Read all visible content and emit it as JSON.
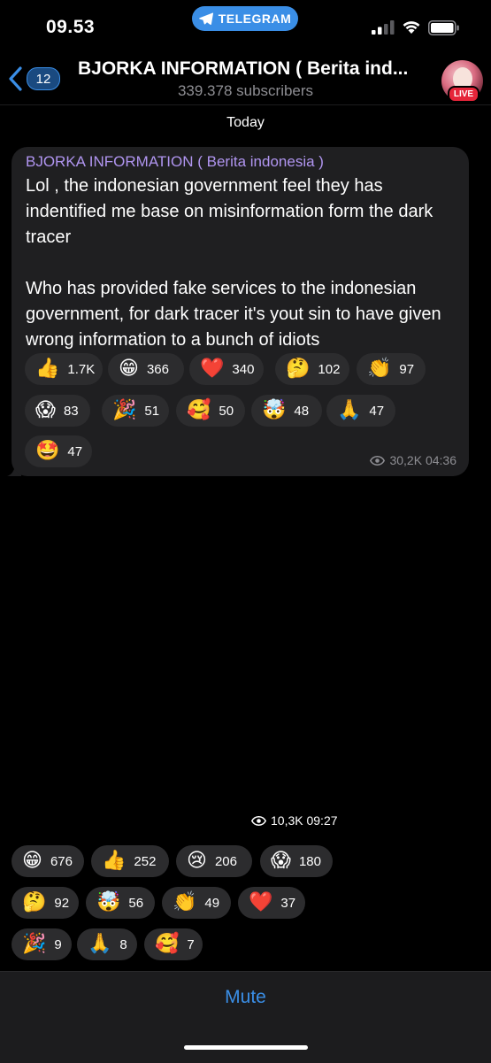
{
  "status_bar": {
    "time": "09.53",
    "app_pill": "TELEGRAM"
  },
  "header": {
    "back_badge": "12",
    "title": "BJORKA INFORMATION ( Berita ind...",
    "subtitle": "339.378 subscribers",
    "live_badge": "LIVE"
  },
  "date_label": "Today",
  "message1": {
    "author": "BJORKA INFORMATION ( Berita indonesia )",
    "paragraph1": "Lol , the indonesian government feel they has indentified me base on misinformation form the dark tracer",
    "paragraph2": "Who has provided fake services to the indonesian government, for dark tracer it's yout sin to have given wrong information to a bunch of idiots",
    "views": "30,2K",
    "time": "04:36",
    "reactions": [
      {
        "emoji": "👍",
        "name": "thumbs-up-icon",
        "count": "1.7K"
      },
      {
        "emoji": "😁",
        "name": "grin-icon",
        "count": "366"
      },
      {
        "emoji": "❤️",
        "name": "heart-icon",
        "count": "340"
      },
      {
        "emoji": "🤔",
        "name": "thinking-icon",
        "count": "102"
      },
      {
        "emoji": "👏",
        "name": "clap-icon",
        "count": "97"
      },
      {
        "emoji": "😱",
        "name": "scream-icon",
        "count": "83"
      },
      {
        "emoji": "🎉",
        "name": "party-icon",
        "count": "51"
      },
      {
        "emoji": "🥰",
        "name": "smiling-hearts-icon",
        "count": "50"
      },
      {
        "emoji": "🤯",
        "name": "mind-blown-icon",
        "count": "48"
      },
      {
        "emoji": "🙏",
        "name": "pray-icon",
        "count": "47"
      },
      {
        "emoji": "🤩",
        "name": "star-struck-icon",
        "count": "47"
      }
    ]
  },
  "message2": {
    "views": "10,3K",
    "time": "09:27",
    "reactions": [
      {
        "emoji": "😁",
        "name": "grin-icon",
        "count": "676"
      },
      {
        "emoji": "👍",
        "name": "thumbs-up-icon",
        "count": "252"
      },
      {
        "emoji": "😢",
        "name": "crying-icon",
        "count": "206"
      },
      {
        "emoji": "😱",
        "name": "scream-icon",
        "count": "180"
      },
      {
        "emoji": "🤔",
        "name": "thinking-icon",
        "count": "92"
      },
      {
        "emoji": "🤯",
        "name": "mind-blown-icon",
        "count": "56"
      },
      {
        "emoji": "👏",
        "name": "clap-icon",
        "count": "49"
      },
      {
        "emoji": "❤️",
        "name": "heart-icon",
        "count": "37"
      },
      {
        "emoji": "🎉",
        "name": "party-icon",
        "count": "9"
      },
      {
        "emoji": "🙏",
        "name": "pray-icon",
        "count": "8"
      },
      {
        "emoji": "🥰",
        "name": "smiling-hearts-icon",
        "count": "7"
      }
    ]
  },
  "bottom_bar": {
    "mute_label": "Mute"
  },
  "colors": {
    "accent": "#3a8ee6",
    "author": "#b095f0",
    "bubble": "#1f1f21",
    "reaction_bg": "#2c2c2e"
  }
}
